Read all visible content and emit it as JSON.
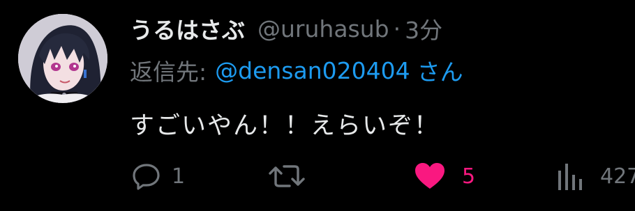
{
  "tweet": {
    "display_name": "うるはさぶ",
    "handle": "@uruhasub",
    "separator": "·",
    "time": "3分",
    "reply_label": "返信先:",
    "reply_target": "@densan020404",
    "reply_suffix": "さん",
    "text": "すごいやん！！えらいぞ！"
  },
  "actions": {
    "reply": {
      "icon": "comment-icon",
      "count": "1"
    },
    "retweet": {
      "icon": "retweet-icon",
      "count": ""
    },
    "like": {
      "icon": "heart-icon",
      "count": "5",
      "liked": true
    },
    "views": {
      "icon": "bar-chart-icon",
      "count": "427"
    }
  },
  "colors": {
    "background": "#000000",
    "primary_text": "#e7e9ea",
    "secondary_text": "#71767b",
    "link": "#1d9bf0",
    "like": "#f91880"
  }
}
